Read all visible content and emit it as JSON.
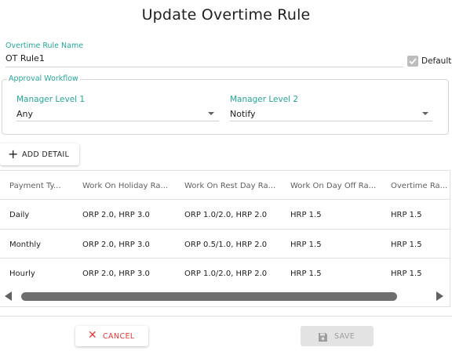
{
  "dialog": {
    "title": "Update Overtime Rule"
  },
  "rule_name": {
    "label": "Overtime Rule Name",
    "value": "OT Rule1"
  },
  "default_checkbox": {
    "label": "Default",
    "checked": true
  },
  "approval_workflow": {
    "legend": "Approval Workflow",
    "manager_level_1": {
      "label": "Manager Level 1",
      "value": "Any"
    },
    "manager_level_2": {
      "label": "Manager Level 2",
      "value": "Notify"
    }
  },
  "add_detail": {
    "label": "ADD DETAIL"
  },
  "table": {
    "headers": [
      "Payment Ty...",
      "Work On Holiday Ra...",
      "Work On Rest Day Ra...",
      "Work On Day Off Ra...",
      "Overtime Ra..."
    ],
    "rows": [
      [
        "Daily",
        "ORP 2.0, HRP 3.0",
        "ORP 1.0/2.0, HRP 2.0",
        "HRP 1.5",
        "HRP 1.5"
      ],
      [
        "Monthly",
        "ORP 2.0, HRP 3.0",
        "ORP 0.5/1.0, HRP 2.0",
        "HRP 1.5",
        "HRP 1.5"
      ],
      [
        "Hourly",
        "ORP 2.0, HRP 3.0",
        "ORP 1.0/2.0, HRP 2.0",
        "HRP 1.5",
        "HRP 1.5"
      ]
    ]
  },
  "footer": {
    "cancel_label": "CANCEL",
    "save_label": "SAVE",
    "save_enabled": false
  },
  "colors": {
    "accent": "#26a69a",
    "cancel": "#e53935",
    "disabled": "#9e9e9e"
  }
}
